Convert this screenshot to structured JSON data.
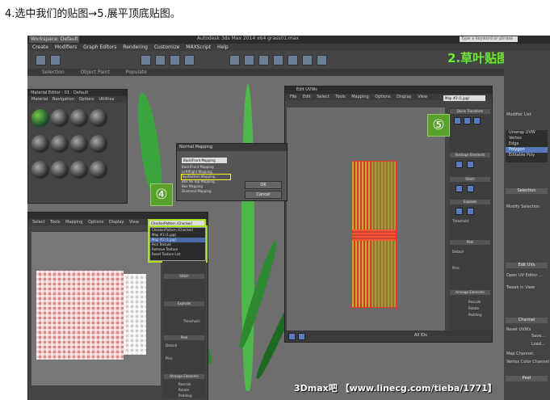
{
  "caption": "4.选中我们的贴图→5.展平顶底贴图。",
  "app": {
    "workspace": "Workspace: Default",
    "window_title": "Autodesk 3ds Max 2014 x64     grass01.max",
    "search_placeholder": "Type a keyword or phrase",
    "menu": [
      "Create",
      "Modifiers",
      "Graph Editors",
      "Rendering",
      "Customize",
      "MAXScript",
      "Help"
    ],
    "ribbon_tabs": [
      "Selection",
      "Object Paint",
      "Populate"
    ]
  },
  "brand_overlay": "2.草叶贴图篇",
  "watermark": "3Dmax吧  【www.linecg.com/tieba/1771】",
  "material_editor": {
    "title": "Material Editor - 01 - Default",
    "menu": [
      "Material",
      "Navigation",
      "Options",
      "Utilities"
    ]
  },
  "normal_mapping": {
    "title": "Normal Mapping",
    "selected": "Back/Front Mapping",
    "options": [
      "Back/Front Mapping",
      "Left/Right Mapping",
      "Top/Bottom Mapping",
      "Box No Top Mapping",
      "Box Mapping",
      "Diamond Mapping"
    ],
    "highlighted_option": "Top/Bottom Mapping",
    "ok_label": "OK",
    "cancel_label": "Cancel"
  },
  "uv_small": {
    "menu": [
      "Select",
      "Tools",
      "Mapping",
      "Options",
      "Display",
      "View"
    ],
    "dropdown": "CheckerPattern (Checker)",
    "list": [
      "CheckerPattern (Checker)",
      "Map #3 (1.jpg)",
      "Map #2 (1.jpg)",
      "",
      "Pick Texture",
      "Remove Texture",
      "Reset Texture List"
    ],
    "side_headers": [
      "Stitch",
      "Explode",
      "Peel",
      "Arrange Elements"
    ],
    "side_rows": [
      "Threshold:",
      "Detach",
      "Pins:",
      "Rescale",
      "Rotate",
      "Padding:"
    ]
  },
  "uv_big": {
    "title": "Edit UVWs",
    "menu": [
      "File",
      "Edit",
      "Select",
      "Tools",
      "Mapping",
      "Options",
      "Display",
      "View"
    ],
    "dropdown": "Map #2 (1.jpg)",
    "side_headers": [
      "Quick Transform",
      "Reshape Elements",
      "Stitch",
      "Explode",
      "Peel",
      "Arrange Elements"
    ],
    "side_rows": [
      "Threshold:",
      "Detach",
      "Pins:",
      "Rescale",
      "Rotate",
      "Padding:"
    ],
    "bottom_field": "All IDs"
  },
  "command_panel": {
    "modifier_list": "Modifier List",
    "stack": [
      "Unwrap UVW",
      "Vertex",
      "Edge",
      "Polygon",
      "Editable Poly"
    ],
    "selected_stack": "Polygon",
    "headers": [
      "Selection",
      "Edit UVs",
      "Channel",
      "Peel"
    ],
    "rows": [
      "Modify Selection",
      "Open UV Editor ...",
      "Tweak In View",
      "Reset UVWs",
      "Save...",
      "Load...",
      "Map Channel:",
      "Vertex Color Channel"
    ]
  },
  "badges": [
    "④",
    "⑤"
  ]
}
